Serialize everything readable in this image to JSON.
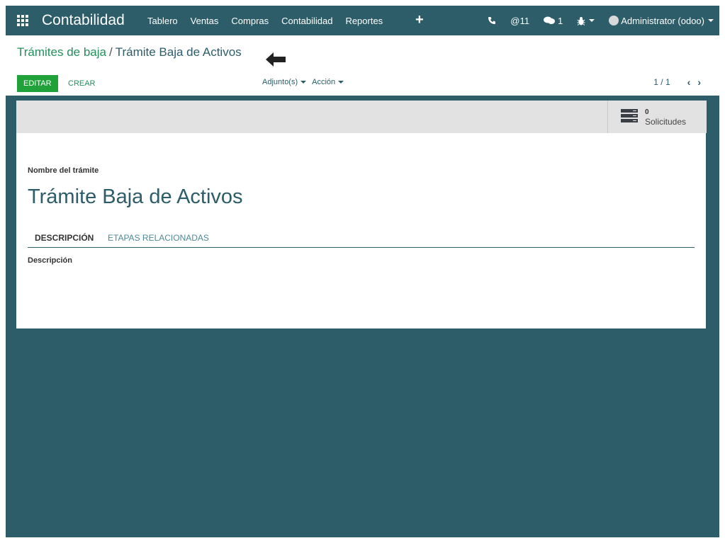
{
  "navbar": {
    "app_title": "Contabilidad",
    "menu": [
      "Tablero",
      "Ventas",
      "Compras",
      "Contabilidad",
      "Reportes"
    ],
    "plus": "+",
    "mentions": "@11",
    "messages": "1",
    "user": "Administrator (odoo)"
  },
  "breadcrumb": {
    "parent": "Trámites de baja",
    "separator": "/",
    "current": "Trámite Baja de Activos"
  },
  "toolbar": {
    "edit_label": "EDITAR",
    "create_label": "CREAR",
    "attachments_label": "Adjunto(s)",
    "action_label": "Acción"
  },
  "pager": {
    "value": "1 / 1"
  },
  "smart_button": {
    "count": "0",
    "label": "Solicitudes"
  },
  "form": {
    "name_label": "Nombre del trámite",
    "name_value": "Trámite Baja de Activos",
    "tabs": [
      "DESCRIPCIÓN",
      "ETAPAS RELACIONADAS"
    ],
    "description_label": "Descripción"
  },
  "colors": {
    "navbar": "#2c5d69",
    "link_green": "#21905a",
    "button_green": "#21a139",
    "statusbar": "#e2e2e2"
  },
  "icons": [
    "apps-grid-icon",
    "phone-icon",
    "chat-icon",
    "bug-icon",
    "back-arrow-icon",
    "chevron-left-icon",
    "chevron-right-icon",
    "server-icon"
  ]
}
